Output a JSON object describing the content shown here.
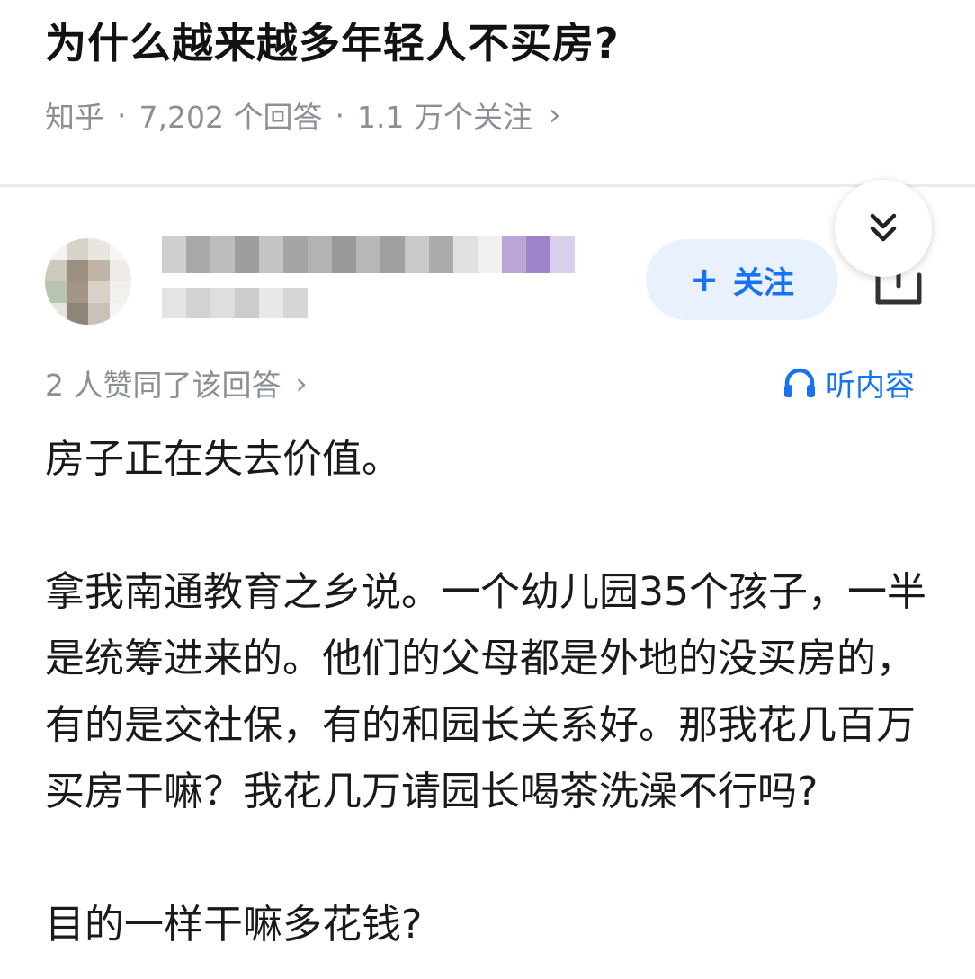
{
  "question": {
    "title": "为什么越来越多年轻人不买房?",
    "meta": {
      "source": "知乎",
      "separator": "·",
      "answers": "7,202 个回答",
      "followers": "1.1 万个关注",
      "chevron": "›"
    }
  },
  "author": {
    "follow_button": {
      "icon": "plus-icon",
      "glyph": "+",
      "label": "关注"
    }
  },
  "answer_bar": {
    "votes_text": "2 人赞同了该回答",
    "votes_chevron": "›",
    "listen_label": "听内容"
  },
  "answer": {
    "paragraphs": [
      "房子正在失去价值。",
      "拿我南通教育之乡说。一个幼儿园35个孩子，一半是统筹进来的。他们的父母都是外地的没买房的，有的是交社保，有的和园长关系好。那我花几百万买房干嘛？我花几万请园长喝茶洗澡不行吗?",
      "目的一样干嘛多花钱?"
    ]
  },
  "colors": {
    "accent": "#1772f6",
    "follow_bg": "#e8f1fd",
    "meta_gray": "#8b8f96",
    "title": "#121212"
  }
}
